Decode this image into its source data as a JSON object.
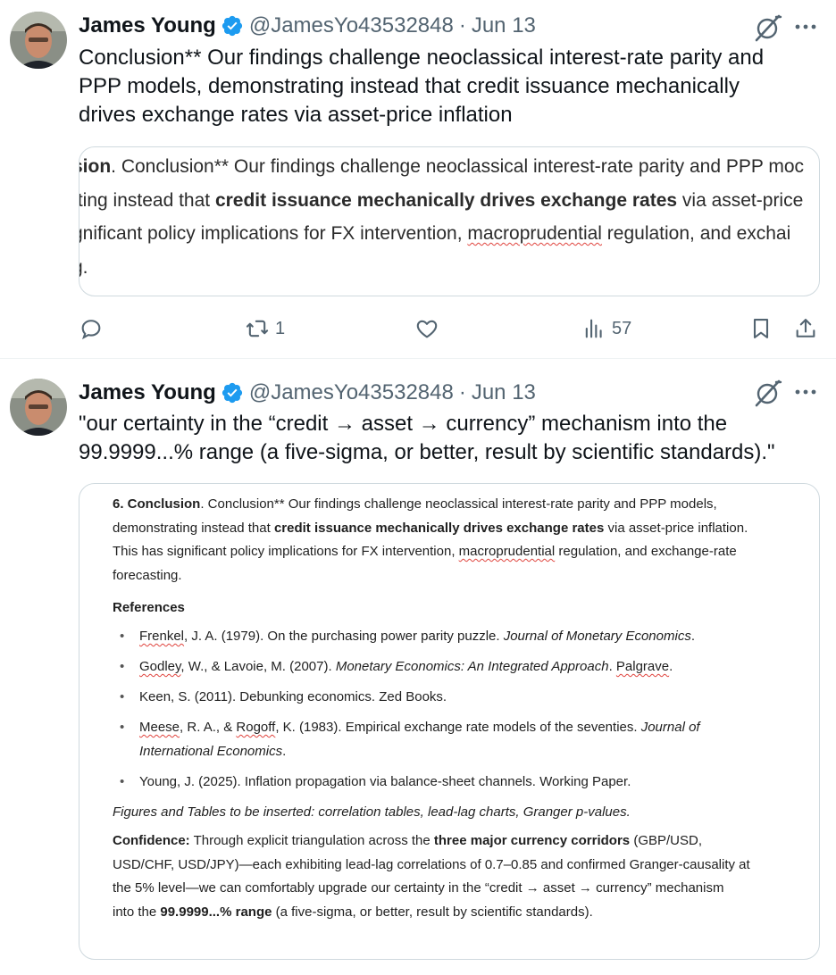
{
  "tweets": [
    {
      "author_name": "James Young",
      "handle": "@JamesYo43532848",
      "separator": "·",
      "date": "Jun 13",
      "text_lines": [
        "Conclusion** Our findings challenge neoclassical interest-rate parity and",
        "PPP models, demonstrating instead that credit issuance mechanically",
        "drives exchange rates via asset-price inflation"
      ],
      "snippet": {
        "line1_bold": "sion",
        "line1": ". Conclusion** Our findings challenge neoclassical interest-rate parity and PPP moc",
        "line2_pre": "ıting instead that ",
        "line2_bold": "credit issuance mechanically drives exchange rates",
        "line2_post": " via asset-price",
        "line3_pre": "gnificant policy implications for FX intervention, ",
        "line3_sq": "macroprudential",
        "line3_post": " regulation, and exchai",
        "line4": "g."
      },
      "actions": {
        "retweets": "1",
        "views": "57"
      }
    },
    {
      "author_name": "James Young",
      "handle": "@JamesYo43532848",
      "separator": "·",
      "date": "Jun 13",
      "text_lines": [
        "\"our certainty in the “credit → asset → currency” mechanism into the",
        "99.9999...% range (a five-sigma, or better, result by scientific standards).\""
      ],
      "document": {
        "section_title": "6. Conclusion",
        "para1_a": ". Conclusion** Our findings challenge neoclassical interest-rate parity and PPP models,",
        "para1_b_pre": "demonstrating instead that ",
        "para1_b_bold": "credit issuance mechanically drives exchange rates",
        "para1_b_post": " via asset-price inflation.",
        "para1_c_pre": "This has significant policy implications for FX intervention, ",
        "para1_c_sq": "macroprudential",
        "para1_c_post": " regulation, and exchange-rate",
        "para1_d": "forecasting.",
        "references_heading": "References",
        "ref1_a": "Frenkel",
        "ref1_b": ", J. A. (1979). On the purchasing power parity puzzle. ",
        "ref1_c": "Journal of Monetary Economics",
        "ref1_d": ".",
        "ref2_a": "Godley",
        "ref2_b": ", W., & Lavoie, M. (2007). ",
        "ref2_c": "Monetary Economics: An Integrated Approach",
        "ref2_d": ". ",
        "ref2_e": "Palgrave",
        "ref2_f": ".",
        "ref3": "Keen, S. (2011). Debunking economics. Zed Books.",
        "ref4_a": "Meese",
        "ref4_b": ", R. A., & ",
        "ref4_c": "Rogoff",
        "ref4_d": ", K. (1983). Empirical exchange rate models of the seventies. ",
        "ref4_e": "Journal of",
        "ref4_f": "International Economics",
        "ref4_g": ".",
        "ref5": "Young, J. (2025). Inflation propagation via balance-sheet channels. Working Paper.",
        "figures_note": "Figures and Tables to be inserted: correlation tables, lead-lag charts, Granger p-values.",
        "conf_label": "Confidence:",
        "conf_l1_pre": " Through explicit triangulation across the ",
        "conf_l1_bold": "three major currency corridors",
        "conf_l1_post": " (GBP/USD,",
        "conf_l2": "USD/CHF, USD/JPY)—each exhibiting lead-lag correlations of 0.7–0.85 and confirmed Granger-causality at",
        "conf_l3": "the 5% level—we can comfortably upgrade our certainty in the “credit → asset → currency” mechanism",
        "conf_l4_pre": "into the ",
        "conf_l4_bold": "99.9999...% range",
        "conf_l4_post": " (a five-sigma, or better, result by scientific standards)."
      }
    }
  ],
  "colors": {
    "verified_blue": "#1d9bf0",
    "secondary_text": "#536471",
    "primary_text": "#0f1419",
    "border": "#cfd9de"
  },
  "icons": [
    "verified-badge-icon",
    "grok-icon",
    "more-icon",
    "reply-icon",
    "retweet-icon",
    "like-icon",
    "views-icon",
    "bookmark-icon",
    "share-icon"
  ]
}
